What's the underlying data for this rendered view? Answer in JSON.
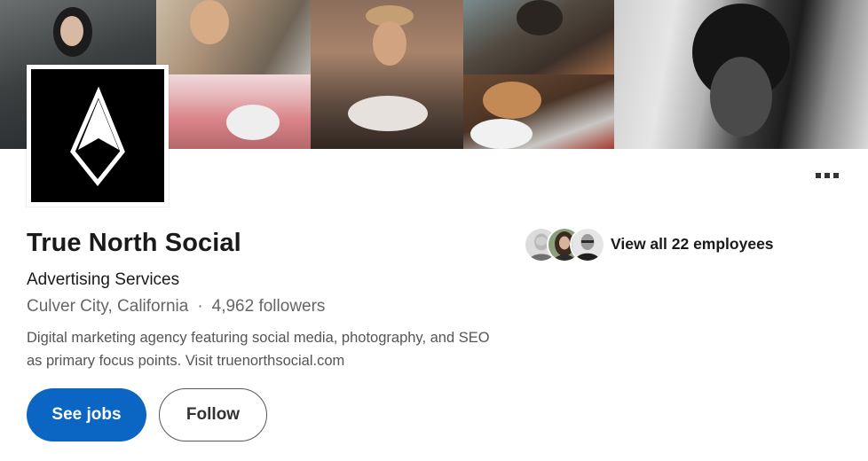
{
  "company": {
    "name": "True North Social",
    "industry": "Advertising Services",
    "location": "Culver City, California",
    "separator": "·",
    "followers": "4,962 followers",
    "tagline": "Digital marketing agency featuring social media, photography, and SEO as primary focus points. Visit truenorthsocial.com"
  },
  "employees": {
    "label": "View all 22 employees",
    "avatars": [
      "employee-avatar-1",
      "employee-avatar-2",
      "employee-avatar-3"
    ]
  },
  "actions": {
    "see_jobs_label": "See jobs",
    "follow_label": "Follow",
    "more_icon": "ellipsis-icon"
  },
  "logo": {
    "icon": "compass-arrow-logo",
    "background": "#000000",
    "foreground": "#ffffff"
  },
  "colors": {
    "primary": "#0a66c2",
    "text": "#1a1a1a",
    "muted": "#666666"
  }
}
